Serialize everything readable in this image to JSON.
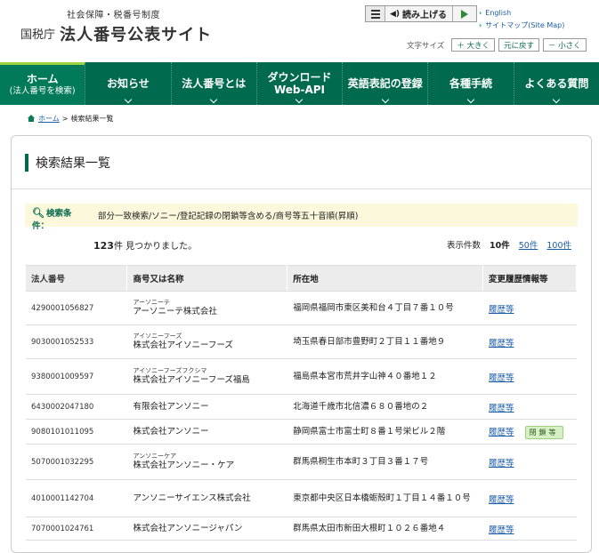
{
  "header": {
    "logo_sub": "社会保障・税番号制度",
    "logo_agency": "国税庁",
    "logo_title": "法人番号公表サイト",
    "read_label": "読み上げる",
    "links": [
      "English",
      "サイトマップ(Site Map)"
    ],
    "font_size_label": "文字サイズ",
    "font_buttons": [
      "＋ 大きく",
      "元に戻す",
      "－ 小さく"
    ]
  },
  "nav": [
    {
      "label": "ホーム",
      "sub": "(法人番号を検索)"
    },
    {
      "label": "お知らせ",
      "sub": ""
    },
    {
      "label": "法人番号とは",
      "sub": ""
    },
    {
      "label": "ダウンロード",
      "sub": "Web-API"
    },
    {
      "label": "英語表記の登録",
      "sub": ""
    },
    {
      "label": "各種手続",
      "sub": ""
    },
    {
      "label": "よくある質問",
      "sub": ""
    }
  ],
  "breadcrumb": {
    "home": "ホーム",
    "current": "検索結果一覧"
  },
  "page_title": "検索結果一覧",
  "condition": {
    "label": "検索条件：",
    "text": "部分一致検索/ソニー/登記記録の閉鎖等含める/商号等五十音順(昇順)"
  },
  "result": {
    "count": "123",
    "count_suffix": "件 見つかりました。",
    "per_page_label": "表示件数",
    "per_page_current": "10件",
    "per_page_options": [
      "50件",
      "100件"
    ]
  },
  "table": {
    "headers": [
      "法人番号",
      "商号又は名称",
      "所在地",
      "変更履歴情報等"
    ],
    "rows": [
      {
        "number": "4290001056827",
        "kana": "アーソニーテ",
        "name": "アーソニーテ株式会社",
        "address": "福岡県福岡市東区美和台４丁目７番１０号",
        "history": "履歴等",
        "badge": ""
      },
      {
        "number": "9030001052533",
        "kana": "アイソニーフーズ",
        "name": "株式会社アイソニーフーズ",
        "address": "埼玉県春日部市豊野町２丁目１１番地９",
        "history": "履歴等",
        "badge": ""
      },
      {
        "number": "9380001009597",
        "kana": "アイソニーフーズフクシマ",
        "name": "株式会社アイソニーフーズ福島",
        "address": "福島県本宮市荒井字山神４０番地１２",
        "history": "履歴等",
        "badge": ""
      },
      {
        "number": "6430002047180",
        "kana": "",
        "name": "有限会社アンソニー",
        "address": "北海道千歳市北信濃６８０番地の２",
        "history": "履歴等",
        "badge": ""
      },
      {
        "number": "9080101011095",
        "kana": "",
        "name": "株式会社アンソニー",
        "address": "静岡県富士市富士町８番１号栄ビル２階",
        "history": "履歴等",
        "badge": "閉鎖等"
      },
      {
        "number": "5070001032295",
        "kana": "アンソニーケア",
        "name": "株式会社アンソニー・ケア",
        "address": "群馬県桐生市本町３丁目３番１７号",
        "history": "履歴等",
        "badge": ""
      },
      {
        "number": "4010001142704",
        "kana": "",
        "name": "アンソニーサイエンス株式会社",
        "address": "東京都中央区日本橋蛎殻町１丁目１４番１０号",
        "history": "履歴等",
        "badge": ""
      },
      {
        "number": "7070001024761",
        "kana": "",
        "name": "株式会社アンソニージャパン",
        "address": "群馬県太田市新田大根町１０２６番地４",
        "history": "履歴等",
        "badge": ""
      }
    ]
  }
}
